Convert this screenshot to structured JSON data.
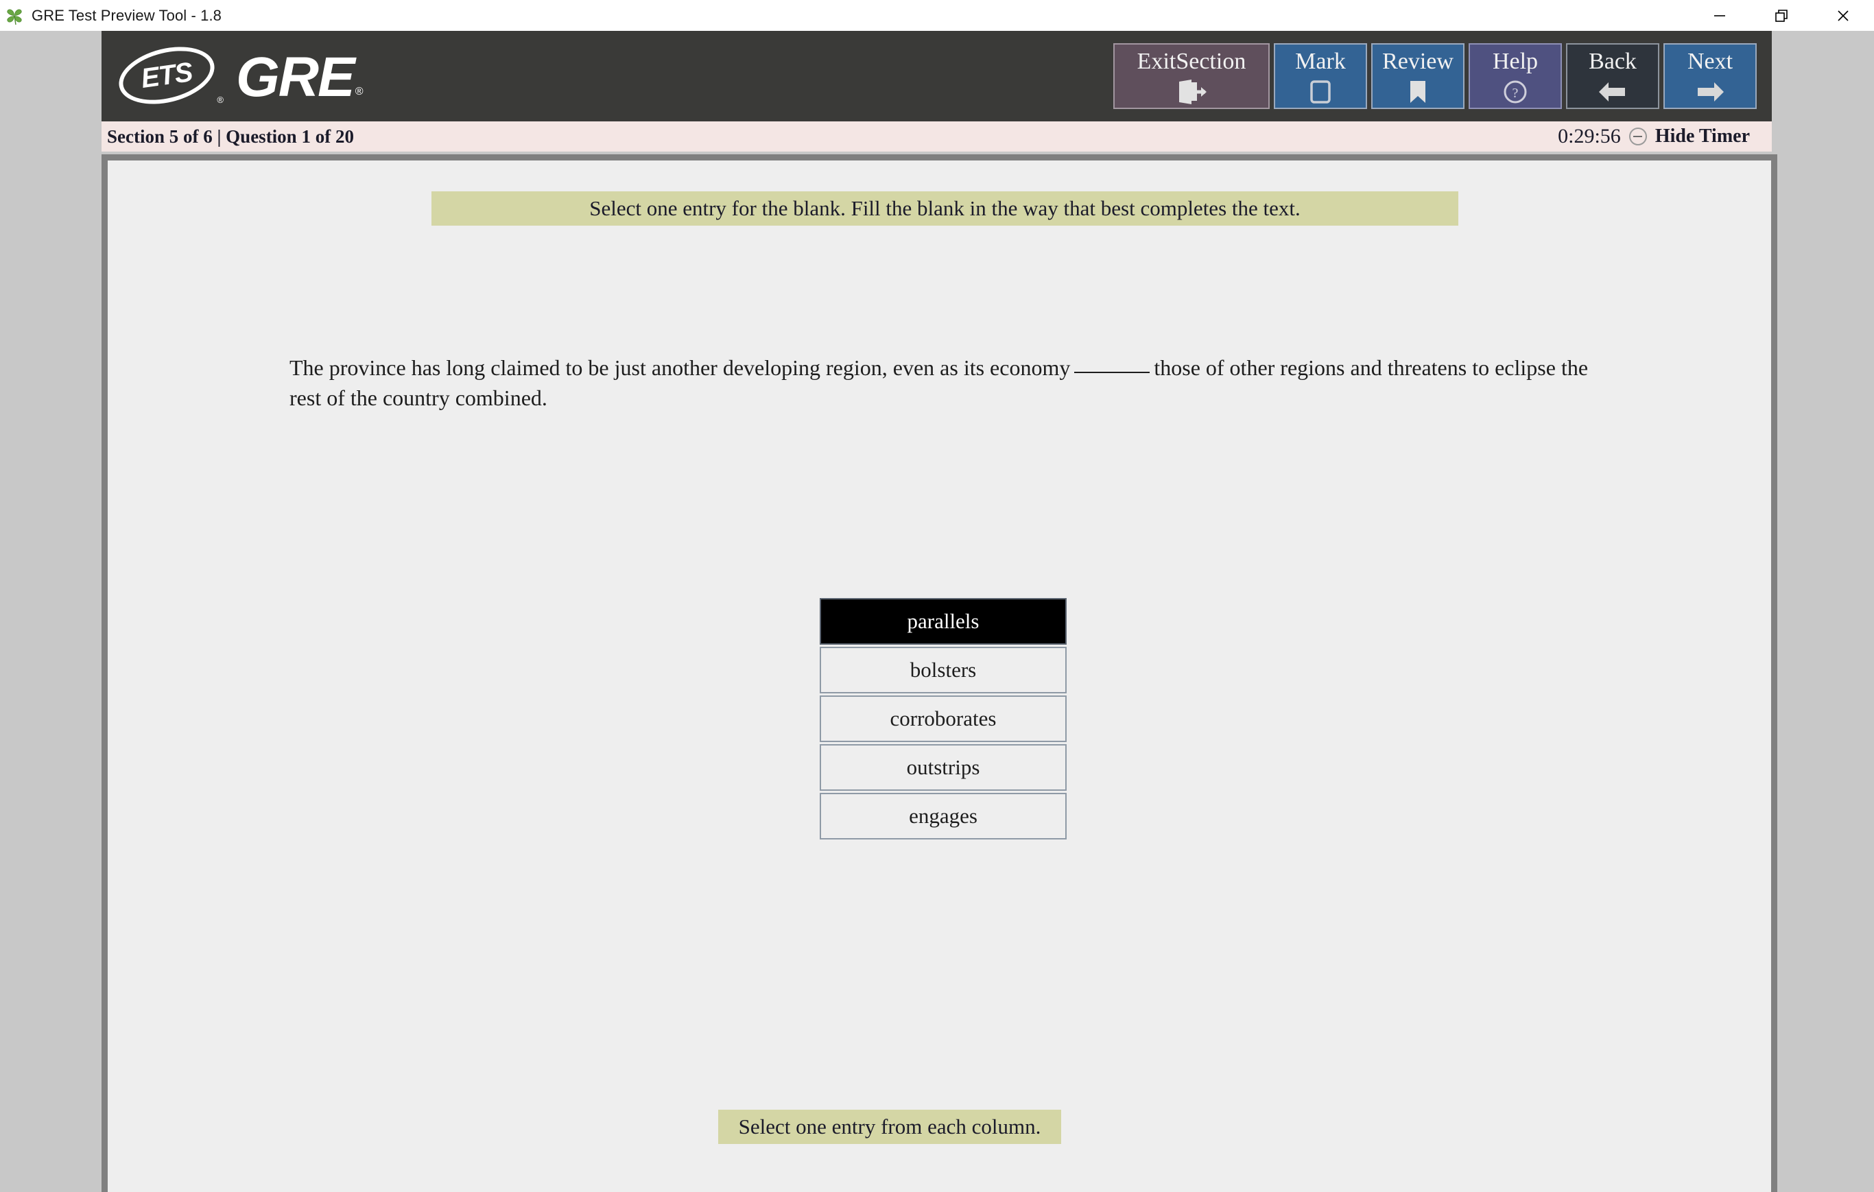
{
  "window": {
    "title": "GRE Test Preview Tool - 1.8",
    "app_icon": "clover-icon",
    "controls": {
      "minimize": "minimize-icon",
      "restore": "restore-icon",
      "close": "close-icon"
    }
  },
  "header": {
    "brand_ets": "ETS",
    "brand_ets_reg": "®",
    "brand_gre": "GRE",
    "brand_gre_reg": "®",
    "buttons": [
      {
        "label": "ExitSection",
        "icon": "exit-door-icon",
        "style": "exit"
      },
      {
        "label": "Mark",
        "icon": "square-outline-icon",
        "style": "mark"
      },
      {
        "label": "Review",
        "icon": "bookmark-icon",
        "style": "review"
      },
      {
        "label": "Help",
        "icon": "question-circle-icon",
        "style": "help"
      },
      {
        "label": "Back",
        "icon": "arrow-left-icon",
        "style": "back"
      },
      {
        "label": "Next",
        "icon": "arrow-right-icon",
        "style": "next"
      }
    ]
  },
  "status_bar": {
    "section_label": "Section 5 of 6 | Question 1 of 20",
    "timer": "0:29:56",
    "hide_timer_label": "Hide Timer",
    "hide_timer_icon": "minus-circle-icon"
  },
  "main": {
    "instruction": "Select one entry for the blank. Fill the blank in the way that best completes the text.",
    "question_part_1": "The province has long claimed to be just another developing region, even as its economy",
    "question_part_2": "those of other regions and threatens to eclipse the rest of the country combined.",
    "options": [
      {
        "label": "parallels",
        "selected": true
      },
      {
        "label": "bolsters",
        "selected": false
      },
      {
        "label": "corroborates",
        "selected": false
      },
      {
        "label": "outstrips",
        "selected": false
      },
      {
        "label": "engages",
        "selected": false
      }
    ],
    "bottom_instruction": "Select one entry from each column."
  },
  "colors": {
    "header_bg": "#3a3a38",
    "section_bar_bg": "#f4e6e4",
    "banner_bg": "#d4d6a5",
    "content_bg": "#eeeeee",
    "frame_bg": "#c8c8c8",
    "accent_blue": "#336394",
    "exit_purple": "#5f4f5c",
    "help_purple": "#4f5180",
    "back_dark": "#2e343c",
    "selected_bg": "#000000"
  }
}
